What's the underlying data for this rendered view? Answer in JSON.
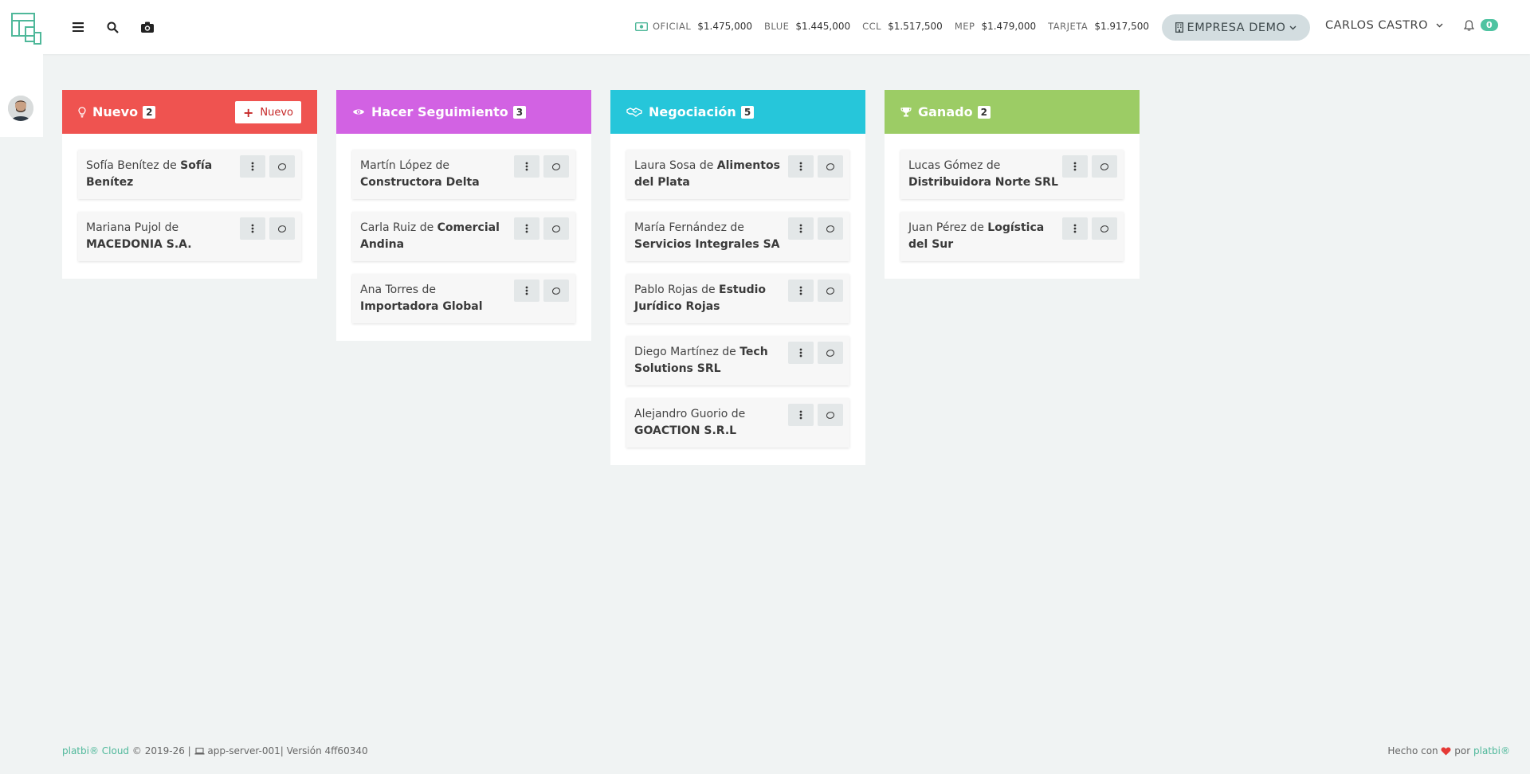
{
  "header": {
    "rates": [
      {
        "label": "OFICIAL",
        "value": "$1.475,000"
      },
      {
        "label": "BLUE",
        "value": "$1.445,000"
      },
      {
        "label": "CCL",
        "value": "$1.517,500"
      },
      {
        "label": "MEP",
        "value": "$1.479,000"
      },
      {
        "label": "TARJETA",
        "value": "$1.917,500"
      }
    ],
    "company": "EMPRESA DEMO",
    "user": "CARLOS CASTRO",
    "notifications": "0"
  },
  "columns": [
    {
      "title": "Nuevo",
      "count": "2",
      "color": "#ef5350",
      "new_button": "Nuevo",
      "cards": [
        {
          "contact": "Sofía Benítez",
          "of": "de",
          "company": "Sofía Benítez"
        },
        {
          "contact": "Mariana Pujol",
          "of": "de",
          "company": "MACEDONIA S.A."
        }
      ]
    },
    {
      "title": "Hacer Seguimiento",
      "count": "3",
      "color": "#d262e3",
      "cards": [
        {
          "contact": "Martín López",
          "of": "de",
          "company": "Constructora Delta"
        },
        {
          "contact": "Carla Ruiz",
          "of": "de",
          "company": "Comercial Andina"
        },
        {
          "contact": "Ana Torres",
          "of": "de",
          "company": "Importadora Global"
        }
      ]
    },
    {
      "title": "Negociación",
      "count": "5",
      "color": "#26c6da",
      "cards": [
        {
          "contact": "Laura Sosa",
          "of": "de",
          "company": "Alimentos del Plata"
        },
        {
          "contact": "María Fernández",
          "of": "de",
          "company": "Servicios Integrales SA"
        },
        {
          "contact": "Pablo Rojas",
          "of": "de",
          "company": "Estudio Jurídico Rojas"
        },
        {
          "contact": "Diego Martínez",
          "of": "de",
          "company": "Tech Solutions SRL"
        },
        {
          "contact": "Alejandro Guorio",
          "of": "de",
          "company": "GOACTION S.R.L"
        }
      ]
    },
    {
      "title": "Ganado",
      "count": "2",
      "color": "#9ccc65",
      "cards": [
        {
          "contact": "Lucas Gómez",
          "of": "de",
          "company": "Distribuidora Norte SRL"
        },
        {
          "contact": "Juan Pérez",
          "of": "de",
          "company": "Logística del Sur"
        }
      ]
    }
  ],
  "footer": {
    "brand": "platbi® Cloud",
    "copyright": "© 2019-26 |",
    "server": "app-server-001| Versión 4ff60340",
    "made_with": "Hecho con",
    "by": "por",
    "by_brand": "platbi®"
  }
}
